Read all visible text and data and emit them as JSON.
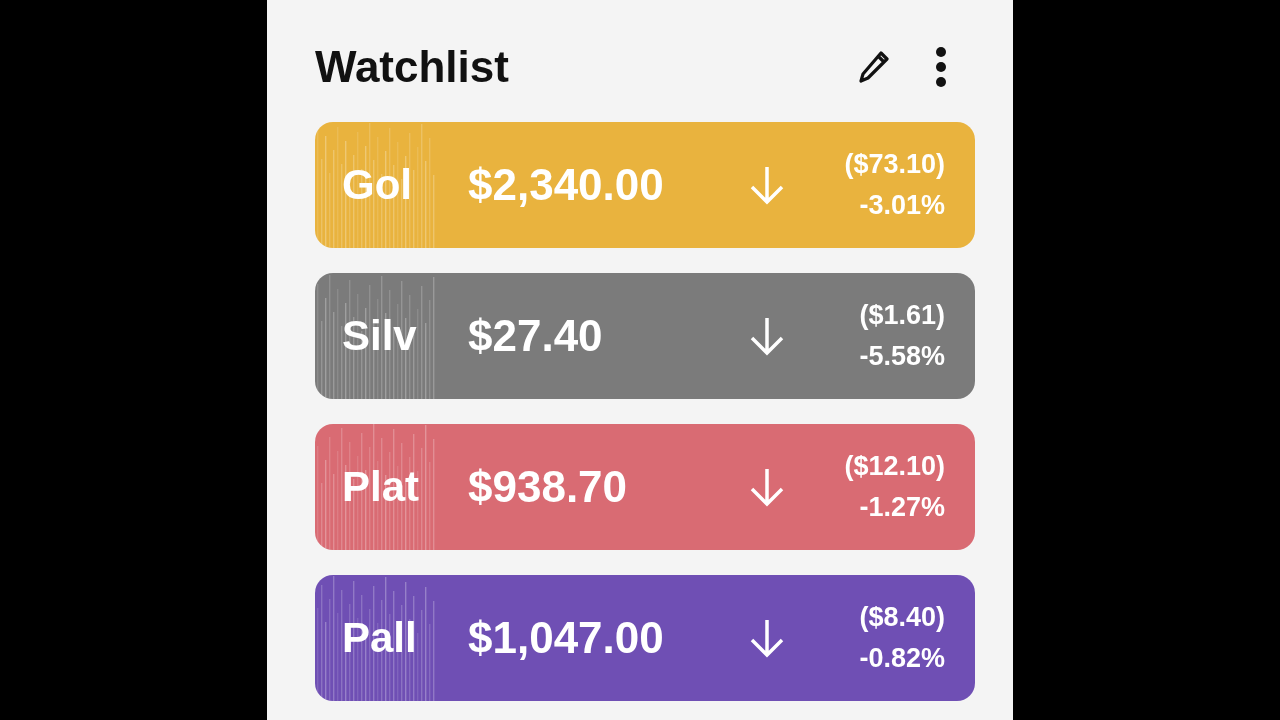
{
  "header": {
    "title": "Watchlist"
  },
  "items": [
    {
      "name": "Gol",
      "price": "$2,340.00",
      "falling": true,
      "change": "($73.10)",
      "percent": "-3.01%",
      "color": "#e9b33e"
    },
    {
      "name": "Silv",
      "price": "$27.40",
      "falling": true,
      "change": "($1.61)",
      "percent": "-5.58%",
      "color": "#7b7b7b"
    },
    {
      "name": "Plat",
      "price": "$938.70",
      "falling": true,
      "change": "($12.10)",
      "percent": "-1.27%",
      "color": "#d96b73"
    },
    {
      "name": "Pall",
      "price": "$1,047.00",
      "falling": true,
      "change": "($8.40)",
      "percent": "-0.82%",
      "color": "#6f4fb4"
    }
  ]
}
